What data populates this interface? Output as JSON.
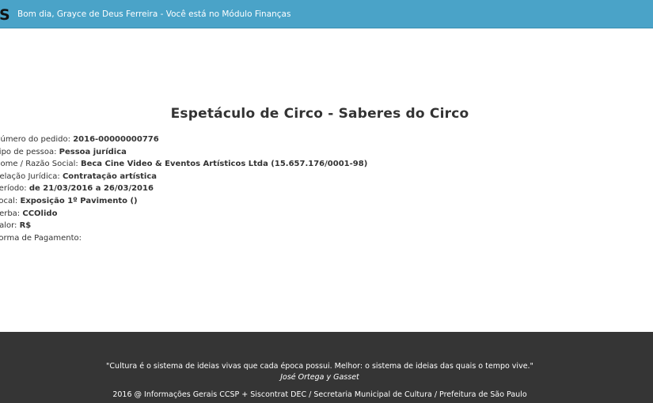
{
  "header": {
    "logo_text": "S",
    "greeting": "Bom dia, Grayce de Deus Ferreira - Você está no Módulo Finanças"
  },
  "main": {
    "title": "Espetáculo de Circo - Saberes do Circo",
    "details": [
      {
        "label": "Número do pedido:",
        "value": "2016-00000000776"
      },
      {
        "label": "Tipo de pessoa:",
        "value": "Pessoa jurídica"
      },
      {
        "label": "Nome / Razão Social:",
        "value": "Beca Cine Video & Eventos Artísticos Ltda (15.657.176/0001-98)"
      },
      {
        "label": "Relação Jurídica:",
        "value": "Contratação artística"
      },
      {
        "label": "Período:",
        "value": "de 21/03/2016 a 26/03/2016"
      },
      {
        "label": "Local:",
        "value": "Exposição 1º Pavimento ()"
      },
      {
        "label": "Verba:",
        "value": "CCOlido"
      },
      {
        "label": "Valor:",
        "value": "R$"
      },
      {
        "label": "Forma de Pagamento:",
        "value": ""
      }
    ]
  },
  "footer": {
    "quote": "\"Cultura é o sistema de ideias vivas que cada época possui. Melhor: o sistema de ideias das quais o tempo vive.\"",
    "author": "José Ortega y Gasset",
    "credits": "2016 @ Informações Gerais CCSP + Siscontrat DEC / Secretaria Municipal de Cultura / Prefeitura de São Paulo"
  },
  "colors": {
    "header_bg": "#4aa3c8",
    "footer_bg": "#353535"
  }
}
